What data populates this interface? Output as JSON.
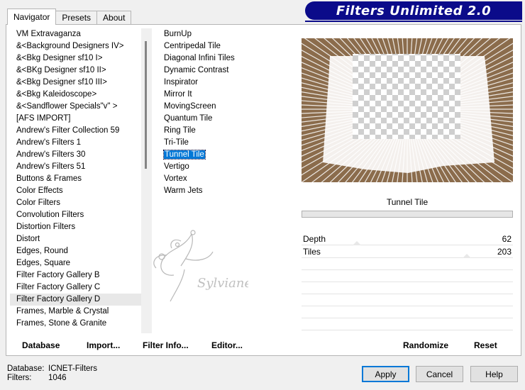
{
  "app": {
    "title": "Filters Unlimited 2.0"
  },
  "tabs": [
    {
      "label": "Navigator",
      "active": true
    },
    {
      "label": "Presets",
      "active": false
    },
    {
      "label": "About",
      "active": false
    }
  ],
  "categories": [
    "VM Extravaganza",
    "&<Background Designers IV>",
    "&<Bkg Designer sf10 I>",
    "&<BKg Designer sf10 II>",
    "&<Bkg Designer sf10 III>",
    "&<Bkg Kaleidoscope>",
    "&<Sandflower Specials\"v\" >",
    "[AFS IMPORT]",
    "Andrew's Filter Collection 59",
    "Andrew's Filters 1",
    "Andrew's Filters 30",
    "Andrew's Filters 51",
    "Buttons & Frames",
    "Color Effects",
    "Color Filters",
    "Convolution Filters",
    "Distortion Filters",
    "Distort",
    "Edges, Round",
    "Edges, Square",
    "Filter Factory Gallery B",
    "Filter Factory Gallery C",
    "Filter Factory Gallery D",
    "Frames, Marble & Crystal",
    "Frames, Stone & Granite"
  ],
  "selected_category": "Filter Factory Gallery D",
  "filters": [
    "BurnUp",
    "Centripedal Tile",
    "Diagonal Infini Tiles",
    "Dynamic Contrast",
    "Inspirator",
    "Mirror It",
    "MovingScreen",
    "Quantum Tile",
    "Ring Tile",
    "Tri-Tile",
    "Tunnel Tile",
    "Vertigo",
    "Vortex",
    "Warm Jets"
  ],
  "selected_filter": "Tunnel Tile",
  "filter_title": "Tunnel Tile",
  "params": [
    {
      "name": "Depth",
      "value": "62",
      "level": 62
    },
    {
      "name": "Tiles",
      "value": "203",
      "level": 203
    }
  ],
  "left_buttons": {
    "database": "Database",
    "import": "Import...",
    "filter_info": "Filter Info...",
    "editor": "Editor..."
  },
  "right_buttons": {
    "randomize": "Randomize",
    "reset": "Reset"
  },
  "status": {
    "database_label": "Database:",
    "database_value": "ICNET-Filters",
    "filters_label": "Filters:",
    "filters_value": "1046"
  },
  "dialog": {
    "apply": "Apply",
    "cancel": "Cancel",
    "help": "Help"
  },
  "colors": {
    "banner": "#0b0b8a",
    "selection": "#0078d7"
  }
}
